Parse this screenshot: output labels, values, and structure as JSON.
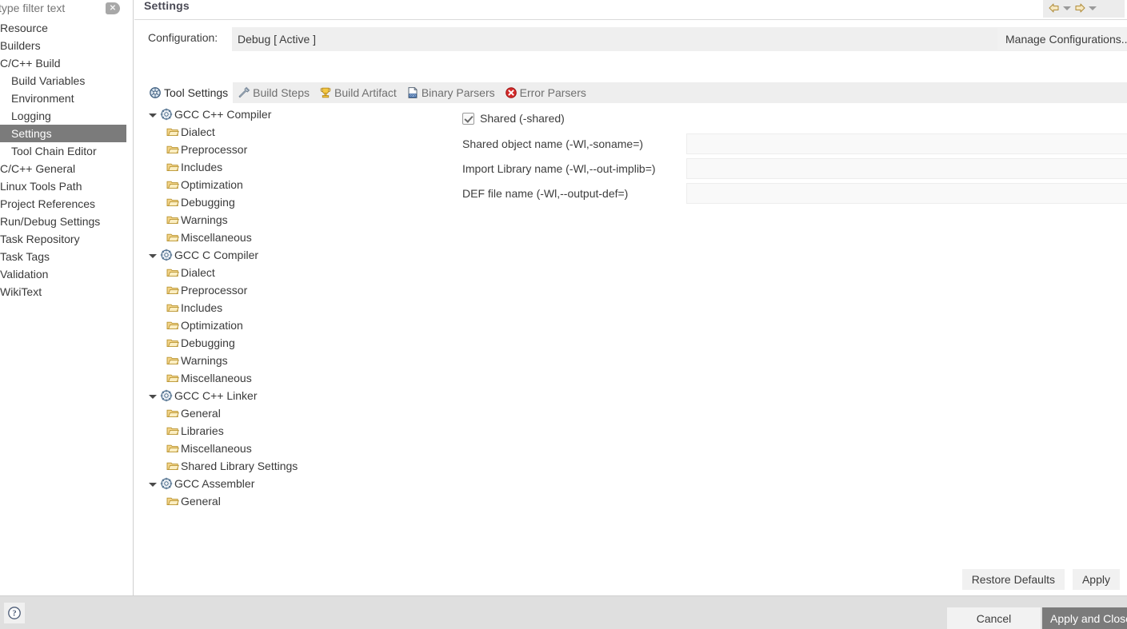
{
  "window": {
    "page_title": "Settings"
  },
  "sidebar": {
    "filter_placeholder": "type filter text",
    "filter_value": "",
    "clear_icon": "clear-filter-icon",
    "items": [
      {
        "label": "Resource",
        "level": 0,
        "selected": false
      },
      {
        "label": "Builders",
        "level": 0,
        "selected": false
      },
      {
        "label": "C/C++ Build",
        "level": 0,
        "selected": false
      },
      {
        "label": "Build Variables",
        "level": 1,
        "selected": false
      },
      {
        "label": "Environment",
        "level": 1,
        "selected": false
      },
      {
        "label": "Logging",
        "level": 1,
        "selected": false
      },
      {
        "label": "Settings",
        "level": 1,
        "selected": true
      },
      {
        "label": "Tool Chain Editor",
        "level": 1,
        "selected": false
      },
      {
        "label": "C/C++ General",
        "level": 0,
        "selected": false
      },
      {
        "label": "Linux Tools Path",
        "level": 0,
        "selected": false
      },
      {
        "label": "Project References",
        "level": 0,
        "selected": false
      },
      {
        "label": "Run/Debug Settings",
        "level": 0,
        "selected": false
      },
      {
        "label": "Task Repository",
        "level": 0,
        "selected": false
      },
      {
        "label": "Task Tags",
        "level": 0,
        "selected": false
      },
      {
        "label": "Validation",
        "level": 0,
        "selected": false
      },
      {
        "label": "WikiText",
        "level": 0,
        "selected": false
      }
    ]
  },
  "nav": {
    "back_icon": "back-arrow-icon",
    "back_menu_icon": "chevron-down-icon",
    "forward_icon": "forward-arrow-icon",
    "forward_menu_icon": "chevron-down-icon"
  },
  "configuration": {
    "label": "Configuration:",
    "value": "Debug  [ Active ]",
    "dropdown_icon": "chevron-down-icon",
    "manage_label": "Manage Configurations..."
  },
  "tabs": [
    {
      "label": "Tool Settings",
      "icon": "tool-settings-icon",
      "active": true
    },
    {
      "label": "Build Steps",
      "icon": "build-steps-icon",
      "active": false
    },
    {
      "label": "Build Artifact",
      "icon": "build-artifact-icon",
      "active": false
    },
    {
      "label": "Binary Parsers",
      "icon": "binary-parsers-icon",
      "active": false
    },
    {
      "label": "Error Parsers",
      "icon": "error-parsers-icon",
      "active": false
    }
  ],
  "tool_tree": [
    {
      "label": "GCC C++ Compiler",
      "type": "parent",
      "expanded": true
    },
    {
      "label": "Dialect",
      "type": "child"
    },
    {
      "label": "Preprocessor",
      "type": "child"
    },
    {
      "label": "Includes",
      "type": "child"
    },
    {
      "label": "Optimization",
      "type": "child"
    },
    {
      "label": "Debugging",
      "type": "child"
    },
    {
      "label": "Warnings",
      "type": "child"
    },
    {
      "label": "Miscellaneous",
      "type": "child"
    },
    {
      "label": "GCC C Compiler",
      "type": "parent",
      "expanded": true
    },
    {
      "label": "Dialect",
      "type": "child"
    },
    {
      "label": "Preprocessor",
      "type": "child"
    },
    {
      "label": "Includes",
      "type": "child"
    },
    {
      "label": "Optimization",
      "type": "child"
    },
    {
      "label": "Debugging",
      "type": "child"
    },
    {
      "label": "Warnings",
      "type": "child"
    },
    {
      "label": "Miscellaneous",
      "type": "child"
    },
    {
      "label": "GCC C++ Linker",
      "type": "parent",
      "expanded": true
    },
    {
      "label": "General",
      "type": "child"
    },
    {
      "label": "Libraries",
      "type": "child"
    },
    {
      "label": "Miscellaneous",
      "type": "child"
    },
    {
      "label": "Shared Library Settings",
      "type": "child"
    },
    {
      "label": "GCC Assembler",
      "type": "parent",
      "expanded": true
    },
    {
      "label": "General",
      "type": "child"
    }
  ],
  "form": {
    "shared_checkbox": {
      "label": "Shared (-shared)",
      "checked": true
    },
    "fields": [
      {
        "label": "Shared object name (-Wl,-soname=)",
        "value": ""
      },
      {
        "label": "Import Library name (-Wl,--out-implib=)",
        "value": ""
      },
      {
        "label": "DEF file name (-Wl,--output-def=)",
        "value": ""
      }
    ]
  },
  "page_buttons": {
    "restore_defaults": "Restore Defaults",
    "apply": "Apply"
  },
  "footer": {
    "help_icon": "help-icon",
    "cancel": "Cancel",
    "apply_and_close": "Apply and Close"
  },
  "colors": {
    "selection": "#7b7b7b",
    "panel_bg": "#ffffff",
    "footer_bg": "#dfdfdf",
    "tab_bar_bg": "#eeeeee",
    "folder_icon": "#f0c040",
    "error_icon": "#d42a2a"
  }
}
